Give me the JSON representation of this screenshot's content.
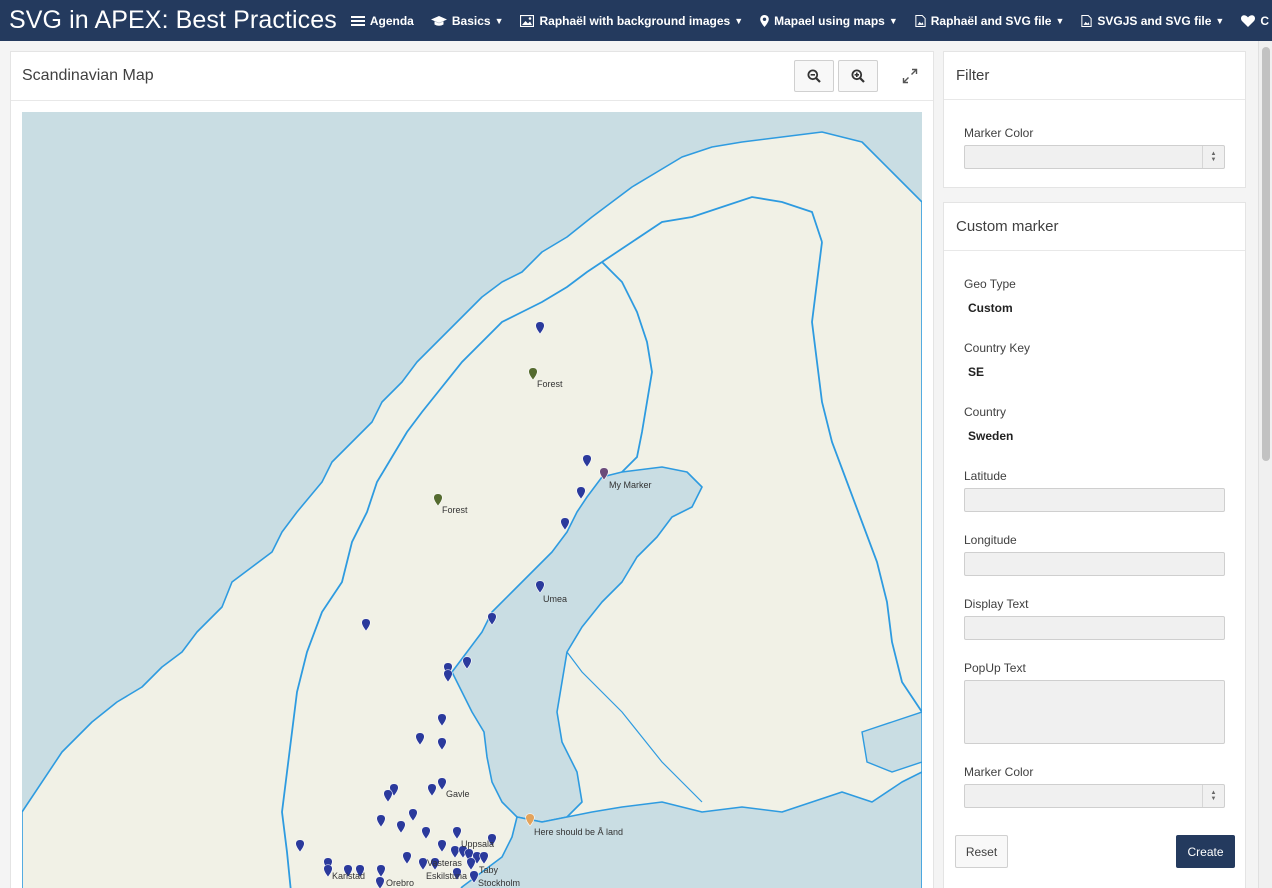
{
  "app": {
    "title": "SVG in APEX: Best Practices"
  },
  "nav": {
    "items": [
      {
        "label": "Agenda",
        "icon": "list-icon",
        "dropdown": false
      },
      {
        "label": "Basics",
        "icon": "graduation-cap-icon",
        "dropdown": true
      },
      {
        "label": "Raphaël with background images",
        "icon": "image-icon",
        "dropdown": true
      },
      {
        "label": "Mapael using maps",
        "icon": "map-marker-icon",
        "dropdown": true
      },
      {
        "label": "Raphaël and SVG file",
        "icon": "file-image-icon",
        "dropdown": true
      },
      {
        "label": "SVGJS and SVG file",
        "icon": "file-image-icon",
        "dropdown": true
      },
      {
        "label": "C",
        "icon": "heart-icon",
        "dropdown": false
      }
    ]
  },
  "map_region": {
    "title": "Scandinavian Map",
    "zoom_out_icon": "zoom-out-icon",
    "zoom_in_icon": "zoom-in-icon",
    "expand_icon": "expand-icon",
    "labels": [
      "Forest",
      "Forest",
      "My Marker",
      "Umea",
      "Gavle",
      "Here should be Å land",
      "Uppsala",
      "Vasteras",
      "Taby",
      "Eskilstuna",
      "Stockholm",
      "Orebro",
      "Karlstad"
    ],
    "colors": {
      "water": "#c9dde3",
      "land": "#f1f1e6",
      "border": "#2e9be0",
      "marker_blue": "#2b3a9c",
      "marker_green": "#556b2f",
      "marker_orange": "#e3a35c",
      "marker_purple": "#6b4c7a"
    }
  },
  "filter": {
    "title": "Filter",
    "marker_color_label": "Marker Color",
    "marker_color_value": ""
  },
  "custom_marker": {
    "title": "Custom marker",
    "geo_type_label": "Geo Type",
    "geo_type_value": "Custom",
    "country_key_label": "Country Key",
    "country_key_value": "SE",
    "country_label": "Country",
    "country_value": "Sweden",
    "latitude_label": "Latitude",
    "latitude_value": "",
    "longitude_label": "Longitude",
    "longitude_value": "",
    "display_text_label": "Display Text",
    "display_text_value": "",
    "popup_text_label": "PopUp Text",
    "popup_text_value": "",
    "marker_color_label": "Marker Color",
    "marker_color_value": "",
    "reset_label": "Reset",
    "create_label": "Create"
  }
}
